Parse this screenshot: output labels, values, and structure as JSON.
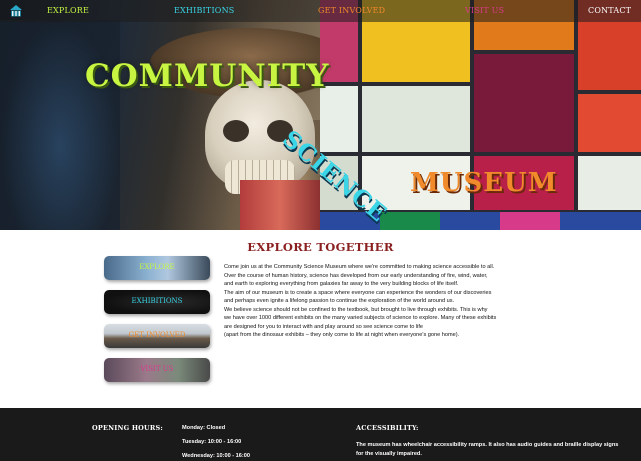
{
  "nav": {
    "items": [
      {
        "label": "EXPLORE",
        "color": "#c7f542"
      },
      {
        "label": "EXHIBITIONS",
        "color": "#3ad6e8"
      },
      {
        "label": "GET INVOLVED",
        "color": "#f08a2a"
      },
      {
        "label": "VISIT US",
        "color": "#d83a8a"
      },
      {
        "label": "CONTACT",
        "color": "#ffffff"
      }
    ],
    "home_icon": "museum-home-icon"
  },
  "hero": {
    "title_community": "COMMUNITY",
    "title_science": "SCIENCE",
    "title_museum": "MUSEUM"
  },
  "main": {
    "title": "EXPLORE TOGETHER",
    "side_buttons": [
      {
        "label": "EXPLORE",
        "color": "#c7f542"
      },
      {
        "label": "EXHIBITIONS",
        "color": "#3ad6e8"
      },
      {
        "label": "GET INVOLVED",
        "color": "#f08a2a"
      },
      {
        "label": "VISIT US",
        "color": "#d83a8a"
      }
    ],
    "intro_lines": [
      "Come join us at the Community Science Museum where we're committed to making science accessible to all.",
      "Over the course of human history, science has developed from our early understanding of fire, wind, water,",
      "and earth to exploring everything from galaxies far away to the very building blocks of life itself.",
      "The aim of our museum is to create a space where everyone can experience the wonders of our discoveries",
      "and perhaps even ignite a lifelong passion to continue the exploration of the world around us.",
      "We believe science should not be confined to the textbook, but brought to live through exhibits. This is why",
      "we have over 1000 different exhibits on the many varied subjects of science to explore. Many of these exhibits",
      "are designed for you to interact with and play around so see science come to life",
      "(apart from the dinosaur exhibits – they only come to life at night when everyone's gone home)."
    ]
  },
  "footer": {
    "hours_heading": "OPENING HOURS:",
    "hours": [
      "Monday: Closed",
      "Tuesday: 10:00 - 16:00",
      "Wednesday: 10:00 - 16:00"
    ],
    "accessibility_heading": "ACCESSIBILITY:",
    "accessibility_text": "The museum has wheelchair accessibility ramps. It also has audio guides and braille display signs for the visually impaired."
  },
  "colors": {
    "title_red": "#8a1f1f",
    "footer_bg": "#1a1a1a"
  }
}
